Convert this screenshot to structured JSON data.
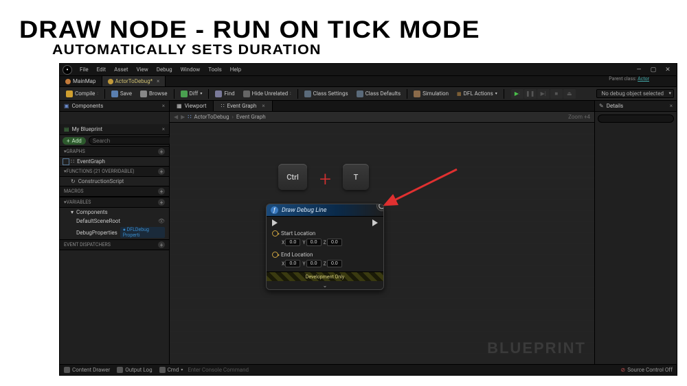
{
  "slide": {
    "title": "DRAW NODE - RUN ON TICK MODE",
    "subtitle": "AUTOMATICALLY SETS DURATION"
  },
  "menu": {
    "items": [
      "File",
      "Edit",
      "Asset",
      "View",
      "Debug",
      "Window",
      "Tools",
      "Help"
    ]
  },
  "parent_class": {
    "label": "Parent class:",
    "value": "Actor"
  },
  "file_tabs": [
    {
      "label": "MainMap",
      "kind": "level"
    },
    {
      "label": "ActorToDebug*",
      "kind": "bp",
      "active": true
    }
  ],
  "toolbar": {
    "compile": "Compile",
    "save": "Save",
    "browse": "Browse",
    "diff": "Diff",
    "find": "Find",
    "hide_unrelated": "Hide Unrelated",
    "class_settings": "Class Settings",
    "class_defaults": "Class Defaults",
    "simulation": "Simulation",
    "dfl_actions": "DFL Actions",
    "debug_object": "No debug object selected"
  },
  "panels": {
    "components": "Components",
    "my_blueprint": "My Blueprint",
    "details": "Details",
    "add": "Add",
    "search_placeholder": "Search"
  },
  "sections": {
    "graphs": "GRAPHS",
    "functions": "FUNCTIONS (21 OVERRIDABLE)",
    "macros": "MACROS",
    "variables": "VARIABLES",
    "event_dispatchers": "EVENT DISPATCHERS"
  },
  "tree": {
    "event_graph": "EventGraph",
    "construction_script": "ConstructionScript",
    "components_header": "Components",
    "default_scene_root": "DefaultSceneRoot",
    "debug_properties": "DebugProperties",
    "dfl_debug_prop": "DFLDebug Properti"
  },
  "center_tabs": {
    "viewport": "Viewport",
    "event_graph": "Event Graph"
  },
  "breadcrumb": {
    "root": "ActorToDebug",
    "leaf": "Event Graph"
  },
  "zoom": "Zoom +4",
  "watermark": "BLUEPRINT",
  "keys": {
    "ctrl": "Ctrl",
    "t": "T",
    "plus": "+"
  },
  "node": {
    "title": "Draw Debug Line",
    "start_location": "Start Location",
    "end_location": "End Location",
    "x": "X",
    "y": "Y",
    "z": "Z",
    "val": "0.0",
    "dev_only": "Development Only",
    "expand": "⌄"
  },
  "statusbar": {
    "content_drawer": "Content Drawer",
    "output_log": "Output Log",
    "cmd": "Cmd",
    "cmd_placeholder": "Enter Console Command",
    "source_control": "Source Control Off"
  }
}
